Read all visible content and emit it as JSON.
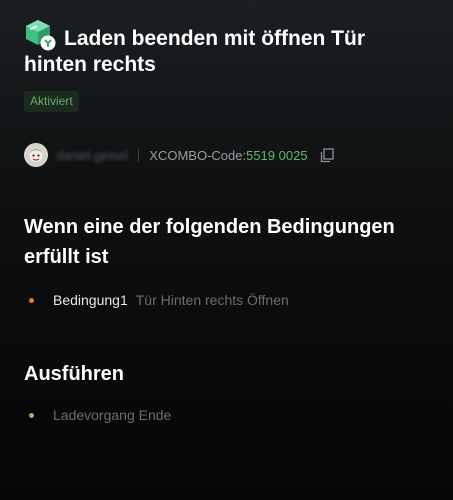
{
  "header": {
    "title_line1": "Laden beenden mit öffnen Tür",
    "title_line2": "hinten rechts",
    "status": "Aktiviert",
    "icon": "scene-cube-icon"
  },
  "author": {
    "username": "daniel.geisel",
    "code_label": "XCOMBO-Code:",
    "code_value": "5519 0025"
  },
  "conditions": {
    "heading_line1": "Wenn eine der folgenden Bedingungen",
    "heading_line2": "erfüllt ist",
    "items": [
      {
        "name": "Bedingung1",
        "description": "Tür Hinten rechts Öffnen",
        "dot_color": "#e07a3a"
      }
    ]
  },
  "actions": {
    "heading": "Ausführen",
    "items": [
      {
        "label": "Ladevorgang Ende",
        "dot_color": "#8bbf6a"
      }
    ]
  },
  "colors": {
    "accent_green": "#62b86b",
    "badge_bg": "#1d2a1f"
  }
}
